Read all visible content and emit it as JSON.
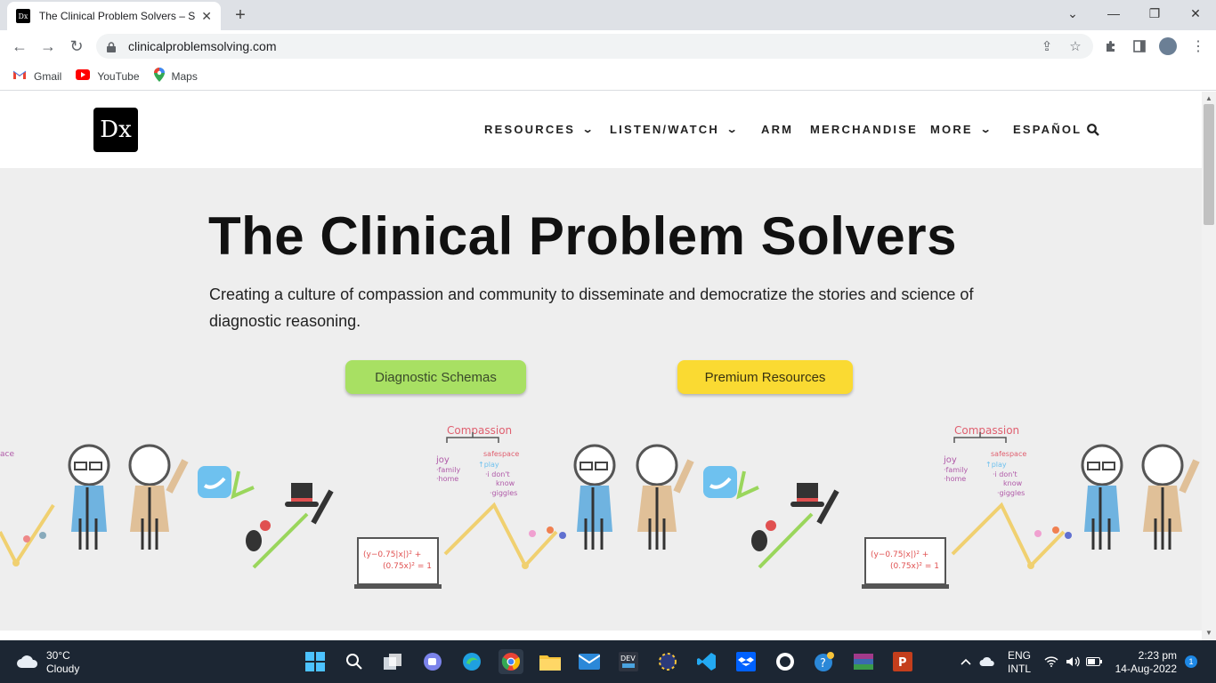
{
  "browser": {
    "tab_title": "The Clinical Problem Solvers – Sh",
    "tab_favicon": "Dx",
    "url": "clinicalproblemsolving.com",
    "bookmarks": [
      {
        "label": "Gmail",
        "icon": "gmail-icon"
      },
      {
        "label": "YouTube",
        "icon": "youtube-icon"
      },
      {
        "label": "Maps",
        "icon": "maps-icon"
      }
    ]
  },
  "site": {
    "logo": "Dx",
    "nav": {
      "resources": "RESOURCES",
      "listen_watch": "LISTEN/WATCH",
      "arm": "ARM",
      "merchandise": "MERCHANDISE",
      "more": "MORE",
      "espanol": "ESPAÑOL"
    },
    "hero": {
      "title": "The Clinical Problem Solvers",
      "subtitle": "Creating a culture of compassion and community to disseminate and democratize the stories and science of diagnostic reasoning.",
      "button_schemas": "Diagnostic Schemas",
      "button_premium": "Premium Resources"
    },
    "illustration": {
      "compassion": "Compassion",
      "safespace": "safespace",
      "joy": "joy",
      "family": "·family",
      "home": "·home",
      "play": "↑play",
      "idk1": "·i don't",
      "idk2": "know",
      "giggles": "·giggles",
      "equation1": "(y−0.75|x|)² +",
      "equation2": "(0.75x)² = 1"
    },
    "colors": {
      "green_button": "#a8e063",
      "yellow_button": "#fada32"
    }
  },
  "taskbar": {
    "temperature": "30°C",
    "condition": "Cloudy",
    "lang1": "ENG",
    "lang2": "INTL",
    "time": "2:23 pm",
    "date": "14-Aug-2022",
    "notification_count": "1"
  }
}
